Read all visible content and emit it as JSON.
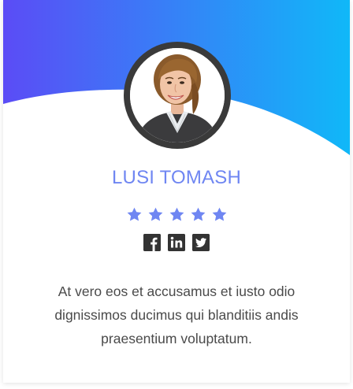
{
  "profile": {
    "name": "LUSI TOMASH",
    "rating": 5,
    "bio": "At vero eos et accusamus et iusto odio dignissimos ducimus qui blanditiis andis praesentium voluptatum."
  },
  "social": [
    {
      "icon": "facebook-icon"
    },
    {
      "icon": "linkedin-icon"
    },
    {
      "icon": "twitter-icon"
    }
  ],
  "colors": {
    "gradient_start": "#5b4cf6",
    "gradient_end": "#10b8f8",
    "name": "#6f86f2",
    "star": "#6f86f2",
    "avatar_ring": "#3a3a3a",
    "text": "#4a4a4a"
  }
}
